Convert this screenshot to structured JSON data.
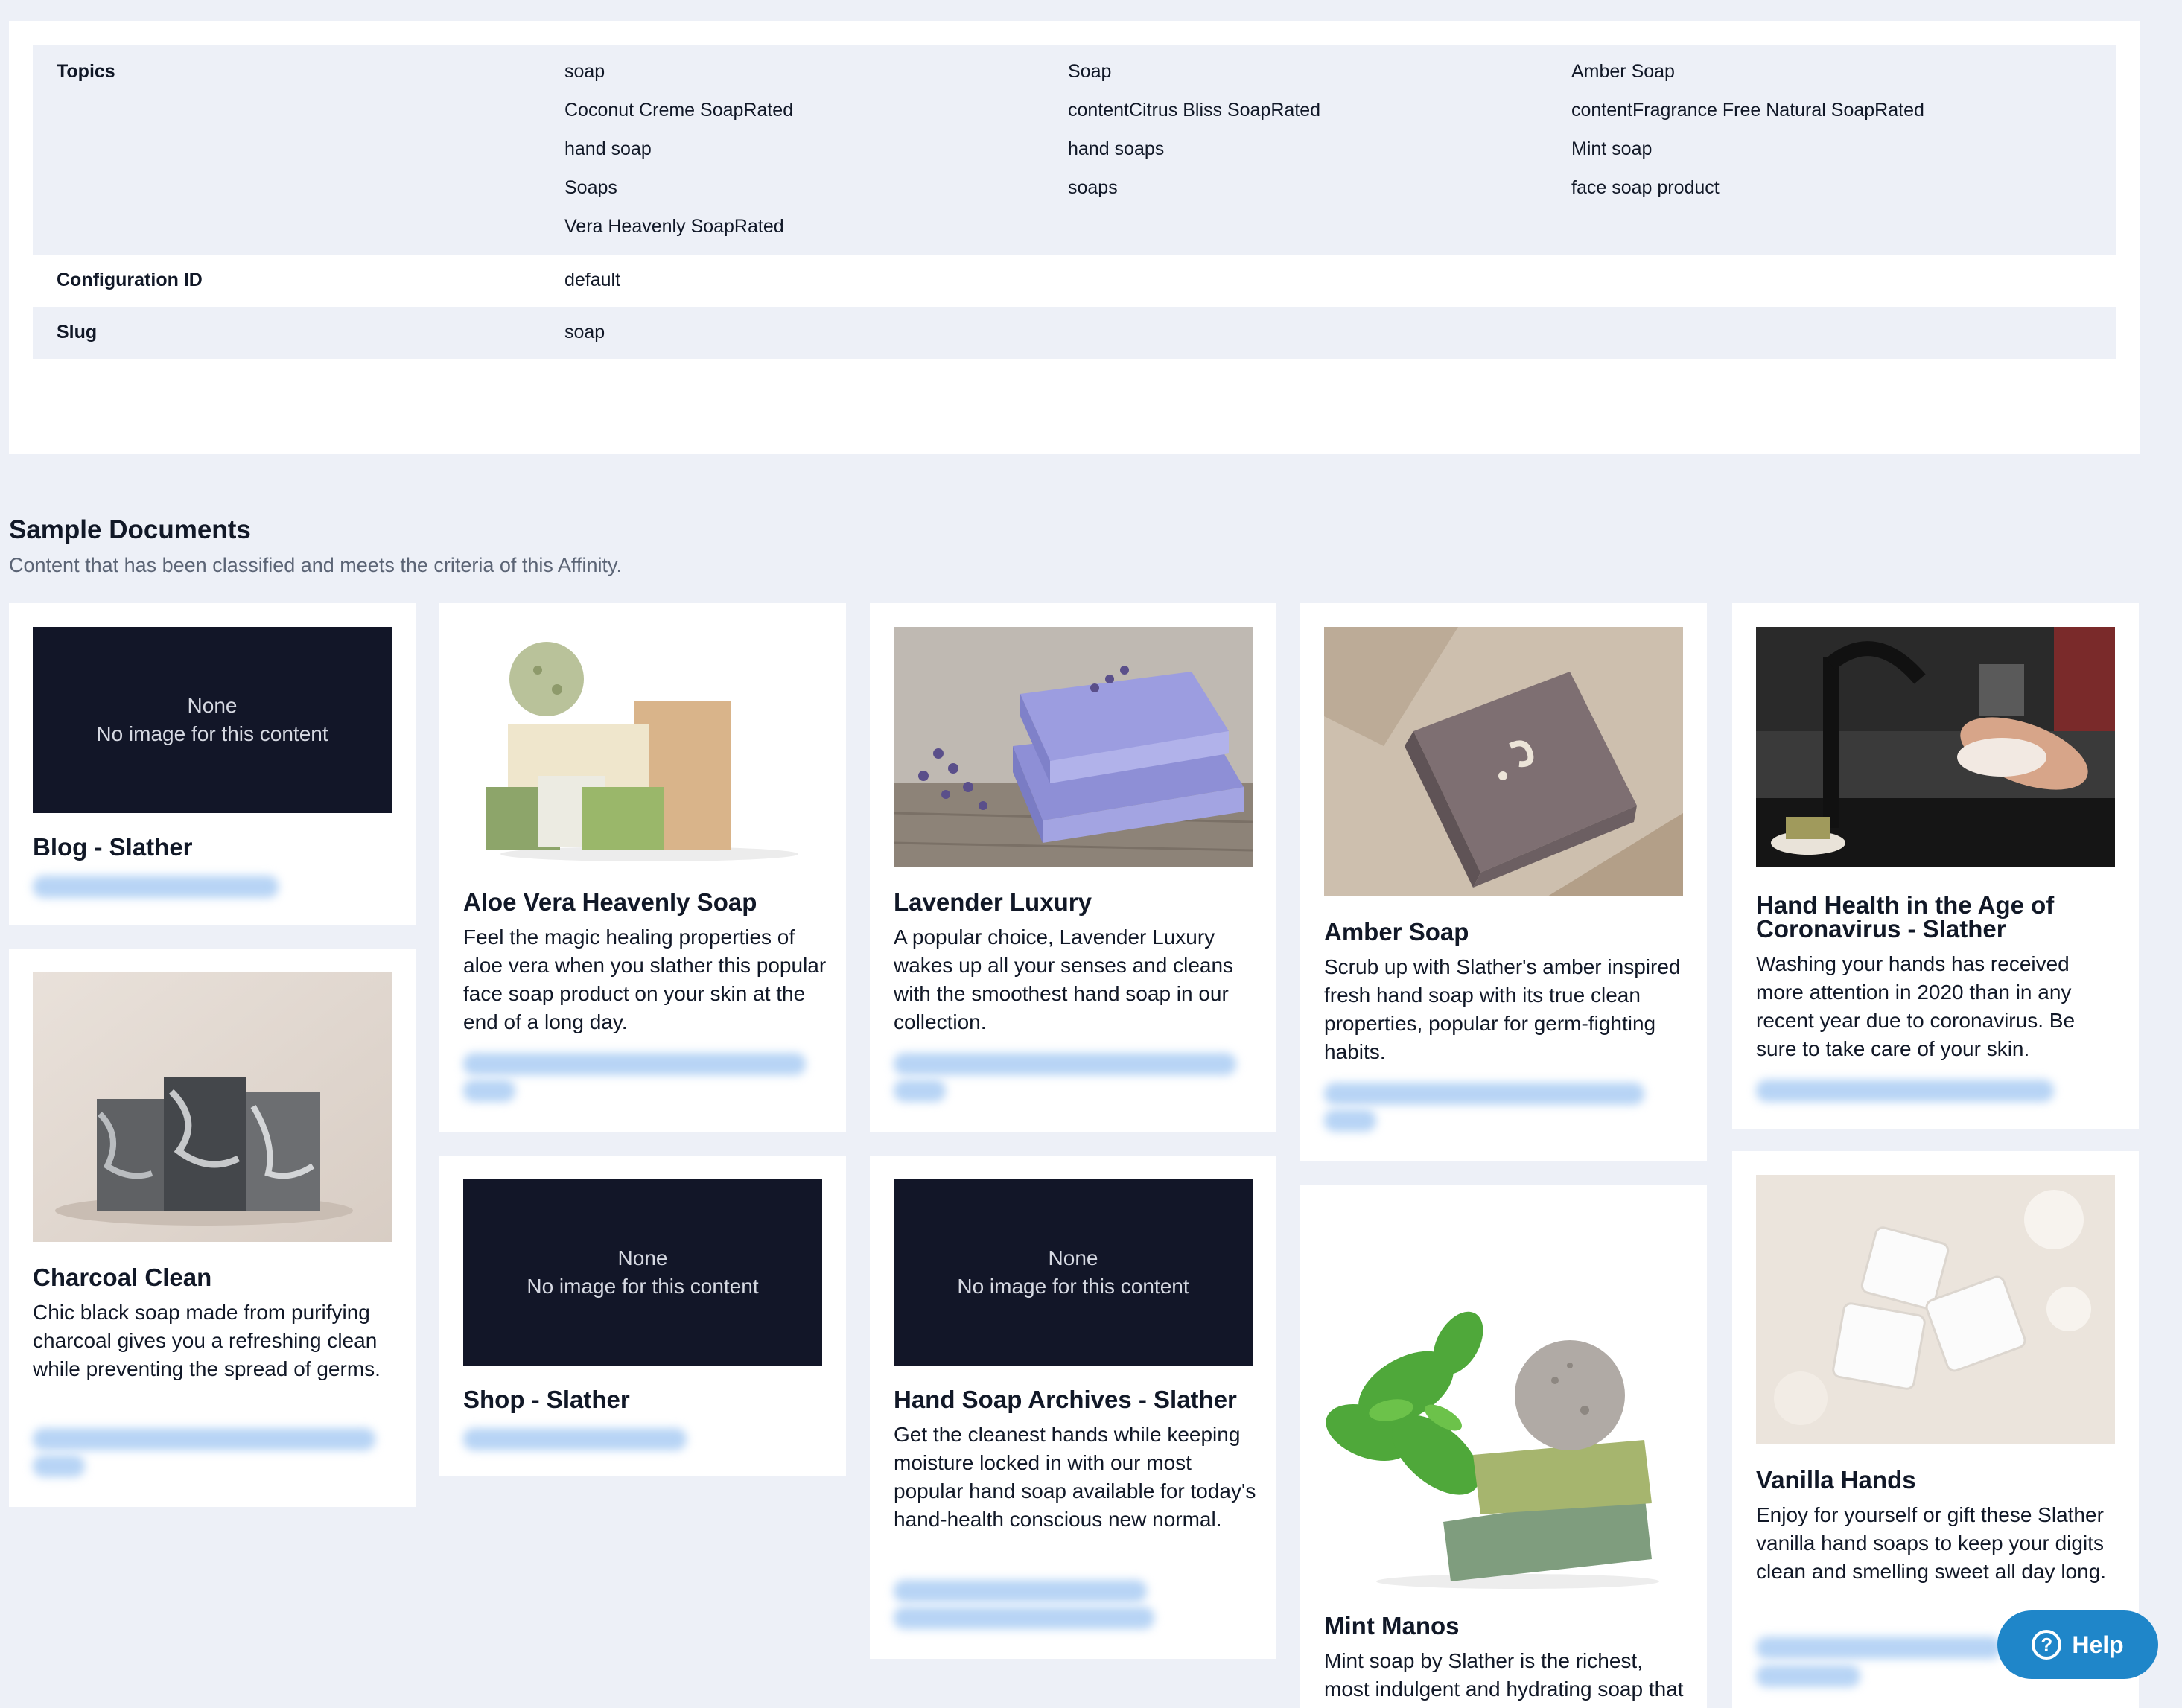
{
  "properties": {
    "topics_label": "Topics",
    "topics": [
      [
        "soap",
        "Soap",
        "Amber Soap"
      ],
      [
        "Coconut Creme SoapRated",
        "contentCitrus Bliss SoapRated",
        "contentFragrance Free Natural SoapRated"
      ],
      [
        "hand soap",
        "hand soaps",
        "Mint soap"
      ],
      [
        "Soaps",
        "soaps",
        "face soap product"
      ],
      [
        "Vera Heavenly SoapRated",
        "",
        ""
      ]
    ],
    "config_label": "Configuration ID",
    "config_value": "default",
    "slug_label": "Slug",
    "slug_value": "soap"
  },
  "section": {
    "title": "Sample Documents",
    "subtitle": "Content that has been classified and meets the criteria of this Affinity."
  },
  "no_image": {
    "line1": "None",
    "line2": "No image for this content"
  },
  "cards": {
    "blog": {
      "title": "Blog - Slather"
    },
    "charcoal": {
      "title": "Charcoal Clean",
      "desc": "Chic black soap made from purifying charcoal gives you a refreshing clean while preventing the spread of germs."
    },
    "aloe": {
      "title": "Aloe Vera Heavenly Soap",
      "desc": "Feel the magic healing properties of aloe vera when you slather this popular face soap product on your skin at the end of a long day."
    },
    "shop": {
      "title": "Shop - Slather"
    },
    "lavender": {
      "title": "Lavender Luxury",
      "desc": "A popular choice, Lavender Luxury wakes up all your senses and cleans with the smoothest hand soap in our collection."
    },
    "archives": {
      "title": "Hand Soap Archives - Slather",
      "desc": "Get the cleanest hands while keeping moisture locked in with our most popular hand soap available for today's hand-health conscious new normal."
    },
    "amber": {
      "title": "Amber Soap",
      "desc": "Scrub up with Slather's amber inspired fresh hand soap with its true clean properties, popular for germ-fighting habits."
    },
    "mint": {
      "title": "Mint Manos",
      "desc": "Mint soap by Slather is the richest, most indulgent and hydrating soap that will freshen all your senses while"
    },
    "hand_health": {
      "title": "Hand Health in the Age of Coronavirus - Slather",
      "desc": "Washing your hands has received more attention in 2020 than in any recent year due to coronavirus. Be sure to take care of your skin."
    },
    "vanilla": {
      "title": "Vanilla Hands",
      "desc": "Enjoy for yourself or gift these Slather vanilla hand soaps to keep your digits clean and smelling sweet all day long."
    }
  },
  "help": {
    "label": "Help"
  }
}
